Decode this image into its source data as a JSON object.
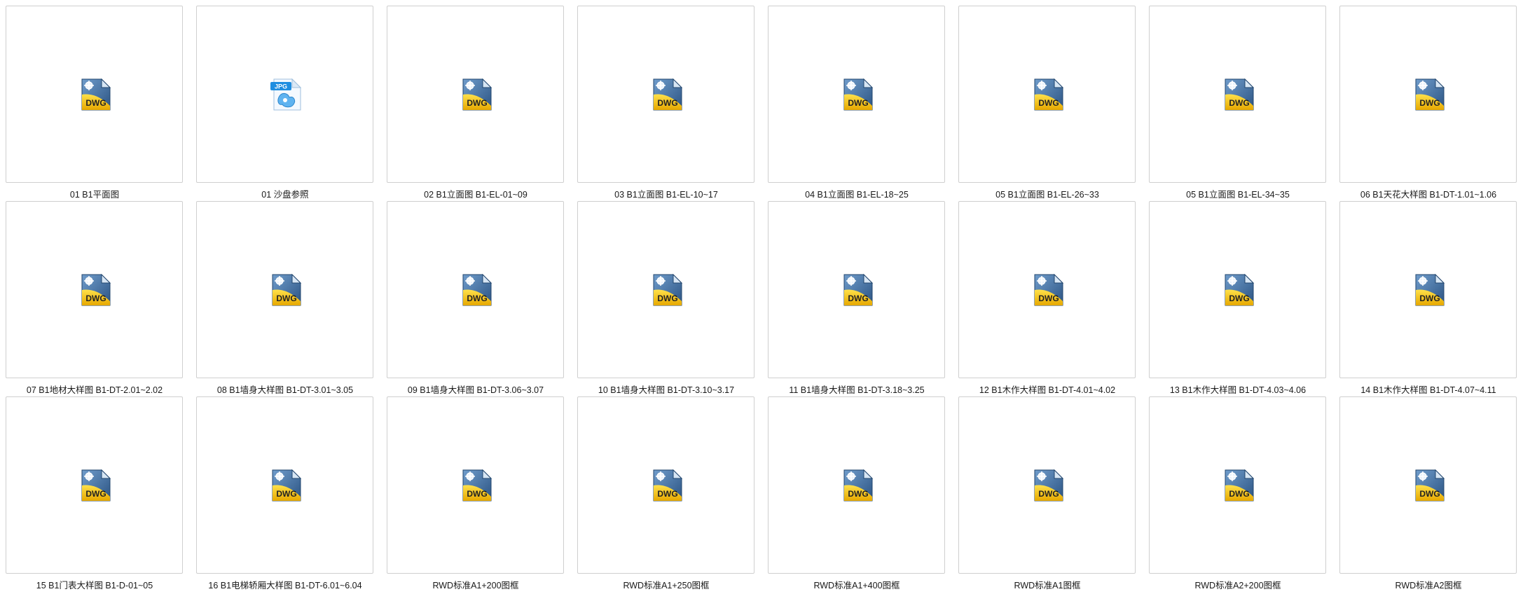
{
  "explorer": {
    "view": "extra-large-icons",
    "files": [
      {
        "name": "01 B1平面图",
        "type": "dwg",
        "icon": "dwg-file-icon",
        "badge": "DWG"
      },
      {
        "name": "01 沙盘参照",
        "type": "jpg",
        "icon": "jpg-file-icon",
        "badge": "JPG"
      },
      {
        "name": "02 B1立面图 B1-EL-01~09",
        "type": "dwg",
        "icon": "dwg-file-icon",
        "badge": "DWG"
      },
      {
        "name": "03 B1立面图 B1-EL-10~17",
        "type": "dwg",
        "icon": "dwg-file-icon",
        "badge": "DWG"
      },
      {
        "name": "04 B1立面图 B1-EL-18~25",
        "type": "dwg",
        "icon": "dwg-file-icon",
        "badge": "DWG"
      },
      {
        "name": "05 B1立面图 B1-EL-26~33",
        "type": "dwg",
        "icon": "dwg-file-icon",
        "badge": "DWG"
      },
      {
        "name": "05 B1立面图 B1-EL-34~35",
        "type": "dwg",
        "icon": "dwg-file-icon",
        "badge": "DWG"
      },
      {
        "name": "06 B1天花大样图 B1-DT-1.01~1.06",
        "type": "dwg",
        "icon": "dwg-file-icon",
        "badge": "DWG"
      },
      {
        "name": "07 B1地材大样图 B1-DT-2.01~2.02",
        "type": "dwg",
        "icon": "dwg-file-icon",
        "badge": "DWG"
      },
      {
        "name": "08 B1墙身大样图 B1-DT-3.01~3.05",
        "type": "dwg",
        "icon": "dwg-file-icon",
        "badge": "DWG"
      },
      {
        "name": "09 B1墙身大样图 B1-DT-3.06~3.07",
        "type": "dwg",
        "icon": "dwg-file-icon",
        "badge": "DWG"
      },
      {
        "name": "10 B1墙身大样图 B1-DT-3.10~3.17",
        "type": "dwg",
        "icon": "dwg-file-icon",
        "badge": "DWG"
      },
      {
        "name": "11 B1墙身大样图 B1-DT-3.18~3.25",
        "type": "dwg",
        "icon": "dwg-file-icon",
        "badge": "DWG"
      },
      {
        "name": "12 B1木作大样图 B1-DT-4.01~4.02",
        "type": "dwg",
        "icon": "dwg-file-icon",
        "badge": "DWG"
      },
      {
        "name": "13 B1木作大样图 B1-DT-4.03~4.06",
        "type": "dwg",
        "icon": "dwg-file-icon",
        "badge": "DWG"
      },
      {
        "name": "14 B1木作大样图 B1-DT-4.07~4.11",
        "type": "dwg",
        "icon": "dwg-file-icon",
        "badge": "DWG"
      },
      {
        "name": "15 B1门表大样图 B1-D-01~05",
        "type": "dwg",
        "icon": "dwg-file-icon",
        "badge": "DWG"
      },
      {
        "name": "16 B1电梯轿厢大样图 B1-DT-6.01~6.04",
        "type": "dwg",
        "icon": "dwg-file-icon",
        "badge": "DWG"
      },
      {
        "name": "RWD标准A1+200图框",
        "type": "dwg",
        "icon": "dwg-file-icon",
        "badge": "DWG"
      },
      {
        "name": "RWD标准A1+250图框",
        "type": "dwg",
        "icon": "dwg-file-icon",
        "badge": "DWG"
      },
      {
        "name": "RWD标准A1+400图框",
        "type": "dwg",
        "icon": "dwg-file-icon",
        "badge": "DWG"
      },
      {
        "name": "RWD标准A1图框",
        "type": "dwg",
        "icon": "dwg-file-icon",
        "badge": "DWG"
      },
      {
        "name": "RWD标准A2+200图框",
        "type": "dwg",
        "icon": "dwg-file-icon",
        "badge": "DWG"
      },
      {
        "name": "RWD标准A2图框",
        "type": "dwg",
        "icon": "dwg-file-icon",
        "badge": "DWG"
      }
    ]
  },
  "colors": {
    "thumb_border": "#cfcfcf",
    "dwg_yellow": "#f5c400",
    "dwg_blue": "#3c6a99",
    "jpg_blue": "#1f8ee0"
  }
}
